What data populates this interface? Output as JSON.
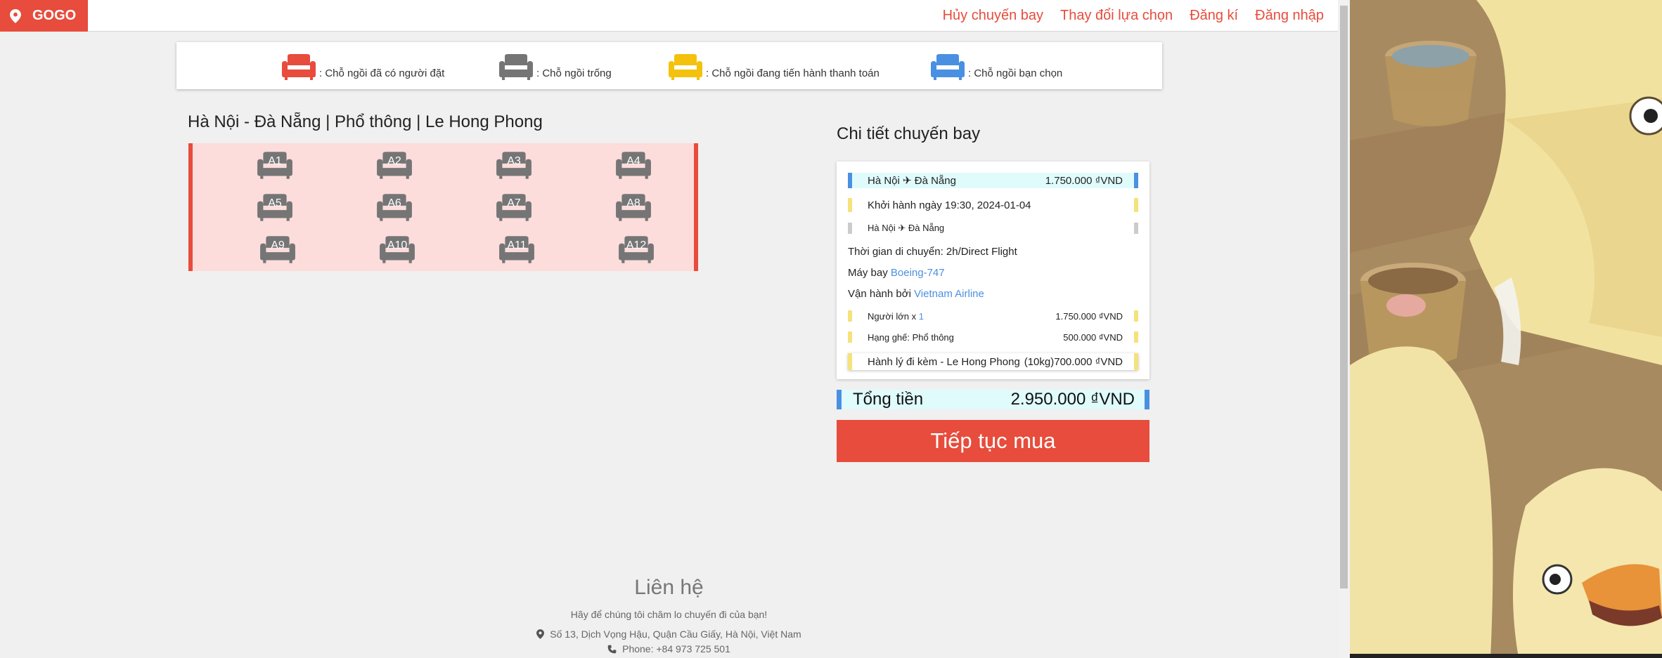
{
  "brand": {
    "name": "GOGO"
  },
  "nav": [
    "Hủy chuyến bay",
    "Thay đổi lựa chọn",
    "Đăng kí",
    "Đăng nhập"
  ],
  "legend": [
    {
      "label": ": Chỗ ngồi đã có người đặt",
      "color": "#e74c3c"
    },
    {
      "label": ": Chỗ ngồi trống",
      "color": "#757575"
    },
    {
      "label": ": Chỗ ngồi đang tiến hành thanh toán",
      "color": "#f4c20d"
    },
    {
      "label": ": Chỗ ngồi bạn chọn",
      "color": "#4a90e2"
    }
  ],
  "route_title": "Hà Nội - Đà Nẵng | Phổ thông | Le Hong Phong",
  "seats": [
    "A1",
    "A2",
    "A3",
    "A4",
    "A5",
    "A6",
    "A7",
    "A8",
    "A9",
    "A10",
    "A11",
    "A12"
  ],
  "details": {
    "title": "Chi tiết chuyến bay",
    "route": "Hà Nội ✈ Đà Nẵng",
    "route_price": "1.750.000 ₫VND",
    "departure": "Khởi hành ngày 19:30, 2024-01-04",
    "route_small": "Hà Nội ✈ Đà Nẵng",
    "duration": "Thời gian di chuyển: 2h/Direct Flight",
    "aircraft_label": "Máy bay",
    "aircraft": "Boeing-747",
    "operator_label": "Vận hành bởi",
    "operator": "Vietnam Airline",
    "adults_label": "Người lớn x",
    "adults_count": "1",
    "adults_price": "1.750.000 ₫VND",
    "class_label": "Hạng ghế: Phổ thông",
    "class_price": "500.000 ₫VND",
    "baggage_label": "Hành lý đi kèm - Le Hong Phong",
    "baggage_price": "(10kg)700.000 ₫VND"
  },
  "total": {
    "label": "Tổng tiền",
    "value": "2.950.000 ₫VND"
  },
  "buy_button": "Tiếp tục mua",
  "footer": {
    "title": "Liên hệ",
    "subtitle": "Hãy để chúng tôi chăm lo chuyến đi của bạn!",
    "address": "Số 13, Dịch Vọng Hậu, Quận Cầu Giấy, Hà Nội, Việt Nam",
    "phone": "Phone: +84 973 725 501"
  }
}
